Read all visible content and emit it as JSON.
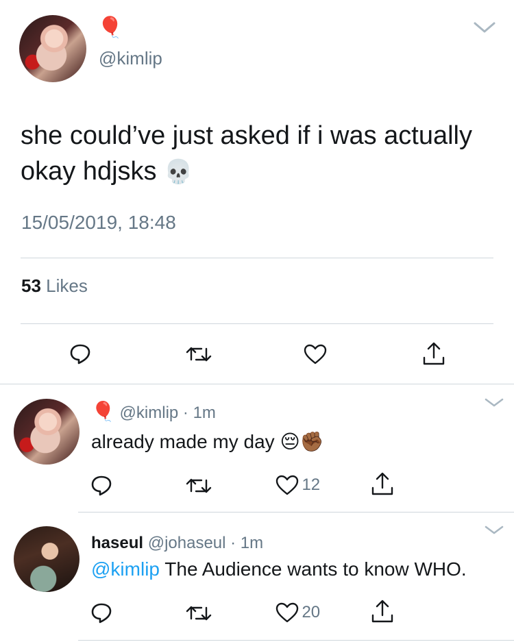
{
  "main_tweet": {
    "handle": "@kimlip",
    "name_emoji": "🎈",
    "text": "she could’ve just asked if i was actually okay hdjsks",
    "text_emoji": "💀",
    "timestamp": "15/05/2019, 18:48",
    "likes_count": "53",
    "likes_label": "Likes"
  },
  "replies": [
    {
      "name_emoji": "🎈",
      "display_name": "",
      "handle": "@kimlip",
      "time": "· 1m",
      "mention": "",
      "text": "already made my day",
      "emojis": "😔✊🏾",
      "likes": "12"
    },
    {
      "name_emoji": "",
      "display_name": "haseul",
      "handle": "@johaseul",
      "time": "· 1m",
      "mention": "@kimlip",
      "text": "The Audience wants to know WHO.",
      "emojis": "",
      "likes": "20"
    }
  ],
  "colors": {
    "text": "#14171a",
    "muted": "#657786",
    "link": "#1da1f2",
    "divider": "#cfd6dc"
  }
}
